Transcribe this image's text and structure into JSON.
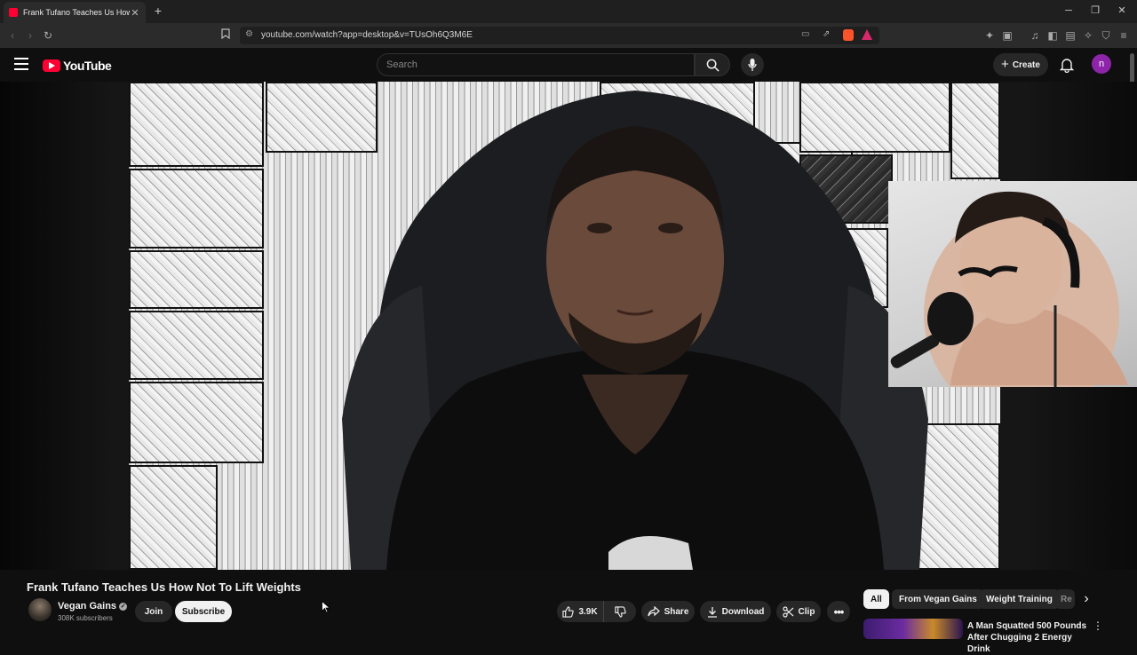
{
  "browser": {
    "tab_title": "Frank Tufano Teaches Us How Not To Lift Weights",
    "url": "youtube.com/watch?app=desktop&v=TUsOh6Q3M6E"
  },
  "header": {
    "logo_text": "YouTube",
    "search_placeholder": "Search",
    "create_label": "Create",
    "avatar_letter": "n"
  },
  "video": {
    "title": "Frank Tufano Teaches Us How Not To Lift Weights",
    "channel": {
      "name": "Vegan Gains",
      "subscribers": "308K subscribers"
    },
    "join_label": "Join",
    "subscribe_label": "Subscribe",
    "likes": "3.9K",
    "share_label": "Share",
    "download_label": "Download",
    "clip_label": "Clip"
  },
  "chips": [
    "All",
    "From Vegan Gains",
    "Weight Training",
    "Re"
  ],
  "recommendations": [
    {
      "title": "A Man Squatted 500 Pounds After Chugging 2 Energy Drink"
    }
  ],
  "colors": {
    "accent": "#ff0033",
    "background": "#0f0f0f",
    "avatar": "#8e24aa"
  }
}
